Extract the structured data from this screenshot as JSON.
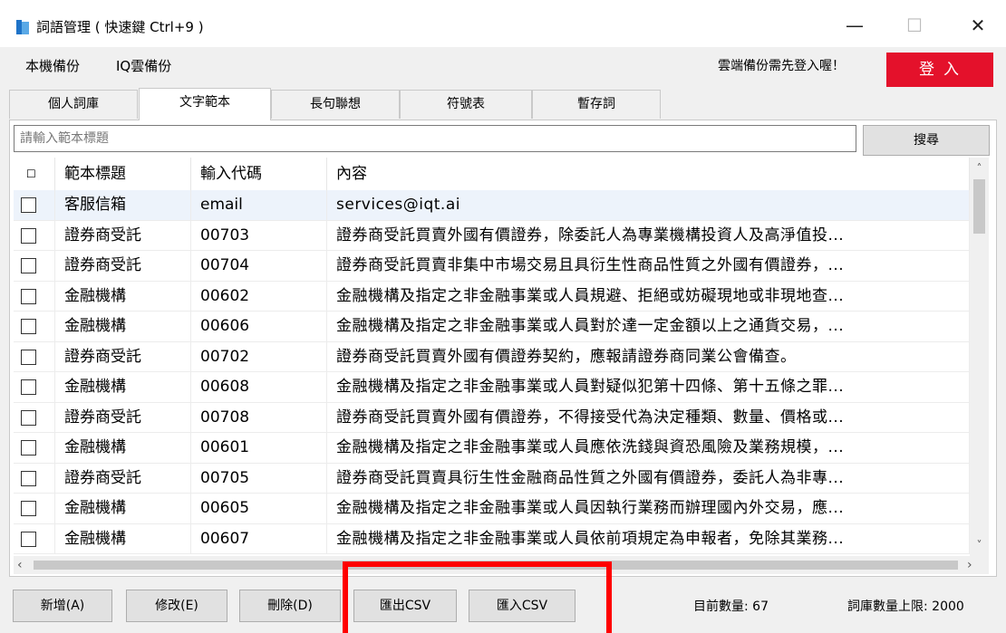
{
  "window": {
    "title": "詞語管理 ( 快速鍵 Ctrl+9 )",
    "minimize_glyph": "—",
    "maximize_glyph": "☐",
    "close_glyph": "✕"
  },
  "menu": {
    "local_backup": "本機備份",
    "cloud_backup": "IQ雲備份",
    "cloud_note": "雲端備份需先登入喔！",
    "login": "登入",
    "login_color": "#e4112b"
  },
  "tabs": [
    {
      "label": "個人詞庫",
      "active": false
    },
    {
      "label": "文字範本",
      "active": true
    },
    {
      "label": "長句聯想",
      "active": false
    },
    {
      "label": "符號表",
      "active": false
    },
    {
      "label": "暫存詞",
      "active": false
    }
  ],
  "search": {
    "placeholder": "請輸入範本標題",
    "value": "",
    "button": "搜尋"
  },
  "table": {
    "headers": {
      "select": "☐",
      "title": "範本標題",
      "code": "輸入代碼",
      "content": "內容"
    },
    "rows": [
      {
        "title": "客服信箱",
        "code": "email",
        "content": "services@iqt.ai"
      },
      {
        "title": "證券商受託",
        "code": "00703",
        "content": "證券商受託買賣外國有價證券，除委託人為專業機構投資人及高淨值投..."
      },
      {
        "title": "證券商受託",
        "code": "00704",
        "content": "證券商受託買賣非集中市場交易且具衍生性商品性質之外國有價證券，..."
      },
      {
        "title": "金融機構",
        "code": "00602",
        "content": "金融機構及指定之非金融事業或人員規避、拒絕或妨礙現地或非現地查..."
      },
      {
        "title": "金融機構",
        "code": "00606",
        "content": "金融機構及指定之非金融事業或人員對於達一定金額以上之通貨交易，..."
      },
      {
        "title": "證券商受託",
        "code": "00702",
        "content": "證券商受託買賣外國有價證券契約，應報請證券商同業公會備查。"
      },
      {
        "title": "金融機構",
        "code": "00608",
        "content": "金融機構及指定之非金融事業或人員對疑似犯第十四條、第十五條之罪..."
      },
      {
        "title": "證券商受託",
        "code": "00708",
        "content": "證券商受託買賣外國有價證券，不得接受代為決定種類、數量、價格或..."
      },
      {
        "title": "金融機構",
        "code": "00601",
        "content": "金融機構及指定之非金融事業或人員應依洗錢與資恐風險及業務規模，..."
      },
      {
        "title": "證券商受託",
        "code": "00705",
        "content": "證券商受託買賣具衍生性金融商品性質之外國有價證券，委託人為非專..."
      },
      {
        "title": "金融機構",
        "code": "00605",
        "content": "金融機構及指定之非金融事業或人員因執行業務而辦理國內外交易，應..."
      },
      {
        "title": "金融機構",
        "code": "00607",
        "content": "金融機構及指定之非金融事業或人員依前項規定為申報者，免除其業務..."
      }
    ]
  },
  "buttons": {
    "add": "新增(A)",
    "edit": "修改(E)",
    "delete": "刪除(D)",
    "export_csv": "匯出CSV",
    "import_csv": "匯入CSV"
  },
  "status": {
    "current_count": "目前數量: 67",
    "limit": "詞庫數量上限: 2000"
  },
  "annotation_color": "#ff0000"
}
